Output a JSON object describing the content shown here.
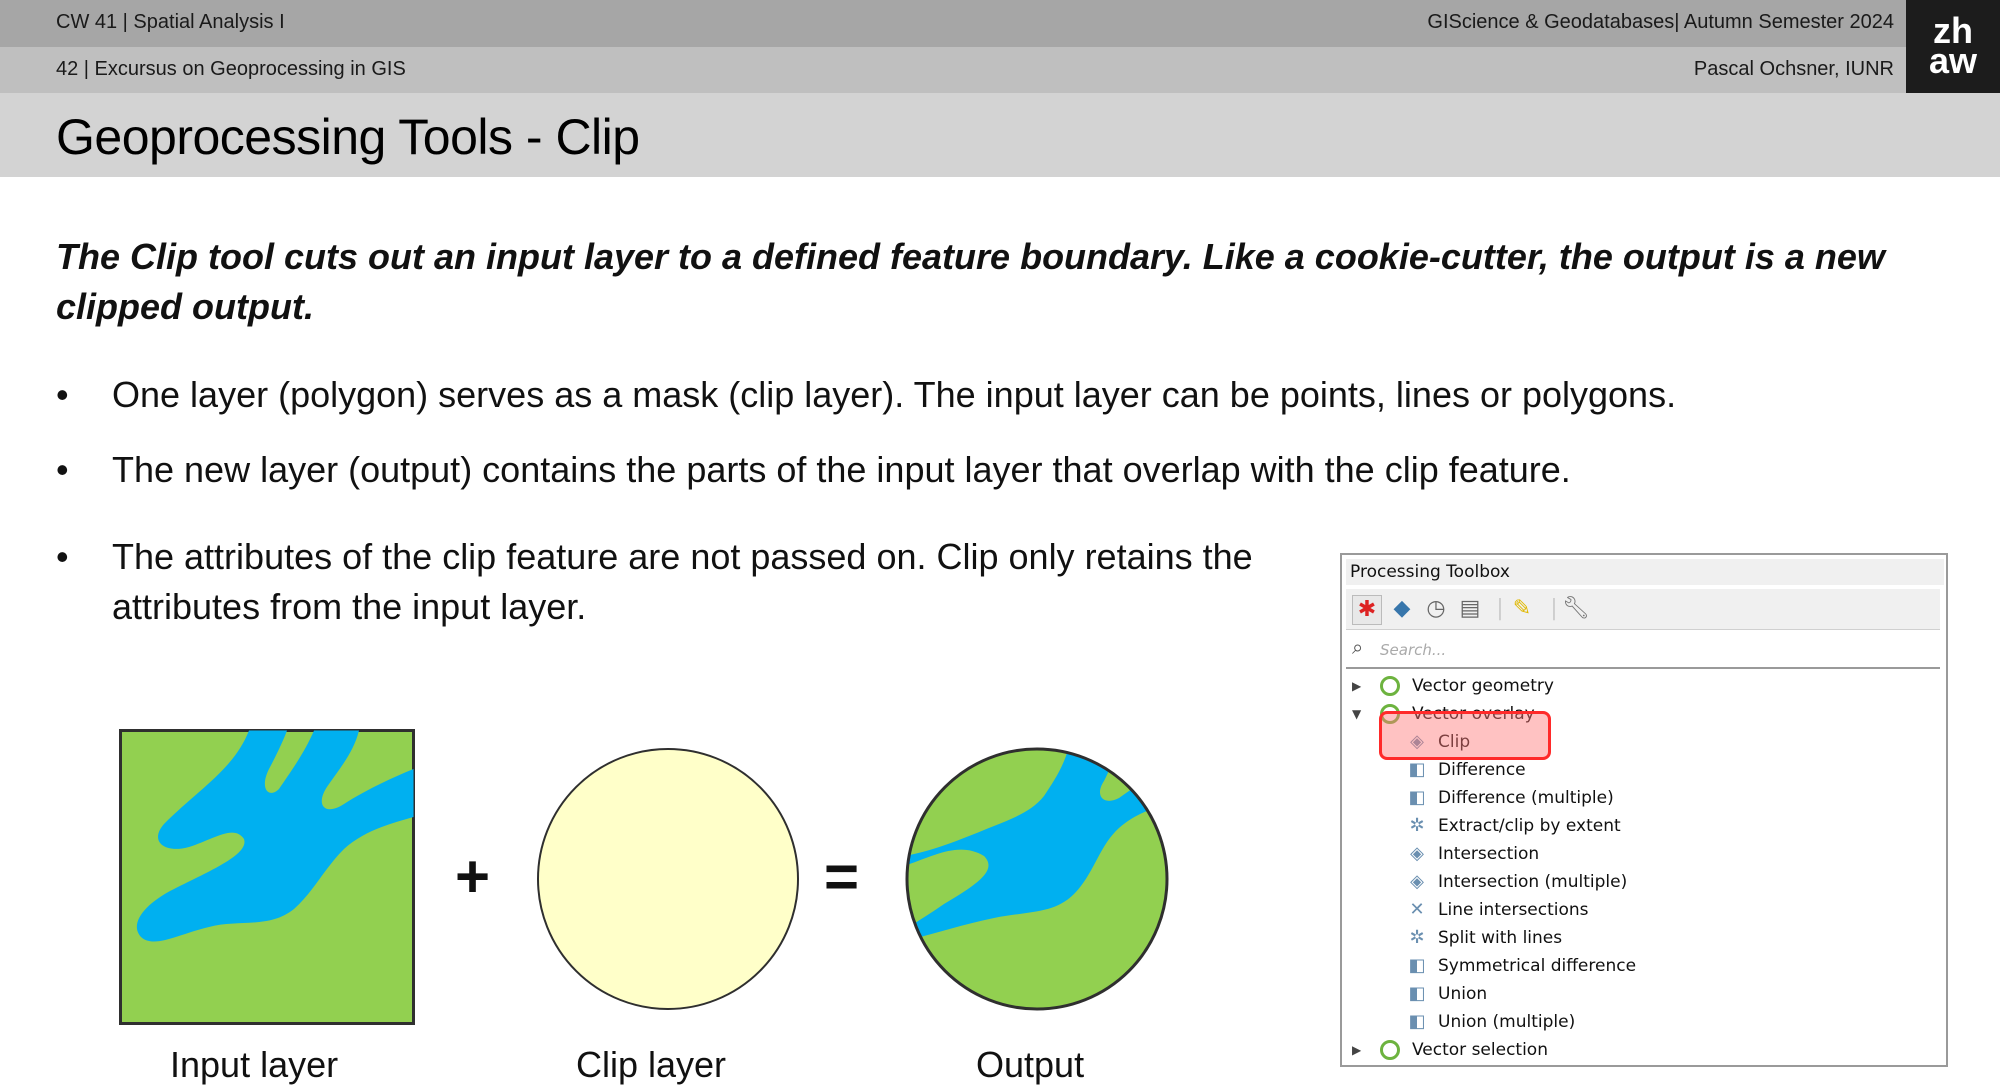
{
  "header": {
    "course_week": "CW 41 | Spatial Analysis I",
    "course_name": "GIScience & Geodatabases| Autumn Semester 2024",
    "slide_ref": "42 | Excursus on Geoprocessing in GIS",
    "author": "Pascal Ochsner, IUNR",
    "logo_line1": "zh",
    "logo_line2": "aw"
  },
  "title": "Geoprocessing Tools - Clip",
  "intro": "The Clip tool cuts out an input layer to a defined feature boundary. Like a cookie-cutter, the output is a new clipped output.",
  "bullets": [
    "One layer (polygon) serves as a mask (clip layer). The input layer can be points, lines or polygons.",
    "The new layer (output) contains the parts of the input layer that overlap with the clip feature.",
    "The attributes of the clip feature are not passed on. Clip only retains the attributes from the input layer."
  ],
  "bullet_symbol": "•",
  "diagram": {
    "input_label": "Input layer",
    "clip_label": "Clip layer",
    "output_label": "Output",
    "plus": "+",
    "equals": "=",
    "colors": {
      "land": "#92d050",
      "water": "#00b0f0",
      "clip": "#ffffc9"
    }
  },
  "toolbox": {
    "title": "Processing Toolbox",
    "search_placeholder": "Search...",
    "groups": [
      {
        "label": "Vector geometry",
        "expanded": false
      },
      {
        "label": "Vector overlay",
        "expanded": true
      },
      {
        "label": "Vector selection",
        "expanded": false
      }
    ],
    "tools": [
      "Clip",
      "Difference",
      "Difference (multiple)",
      "Extract/clip by extent",
      "Intersection",
      "Intersection (multiple)",
      "Line intersections",
      "Split with lines",
      "Symmetrical difference",
      "Union",
      "Union (multiple)"
    ],
    "highlighted_tool": "Clip",
    "highlight_color": "#ff2a2a"
  }
}
